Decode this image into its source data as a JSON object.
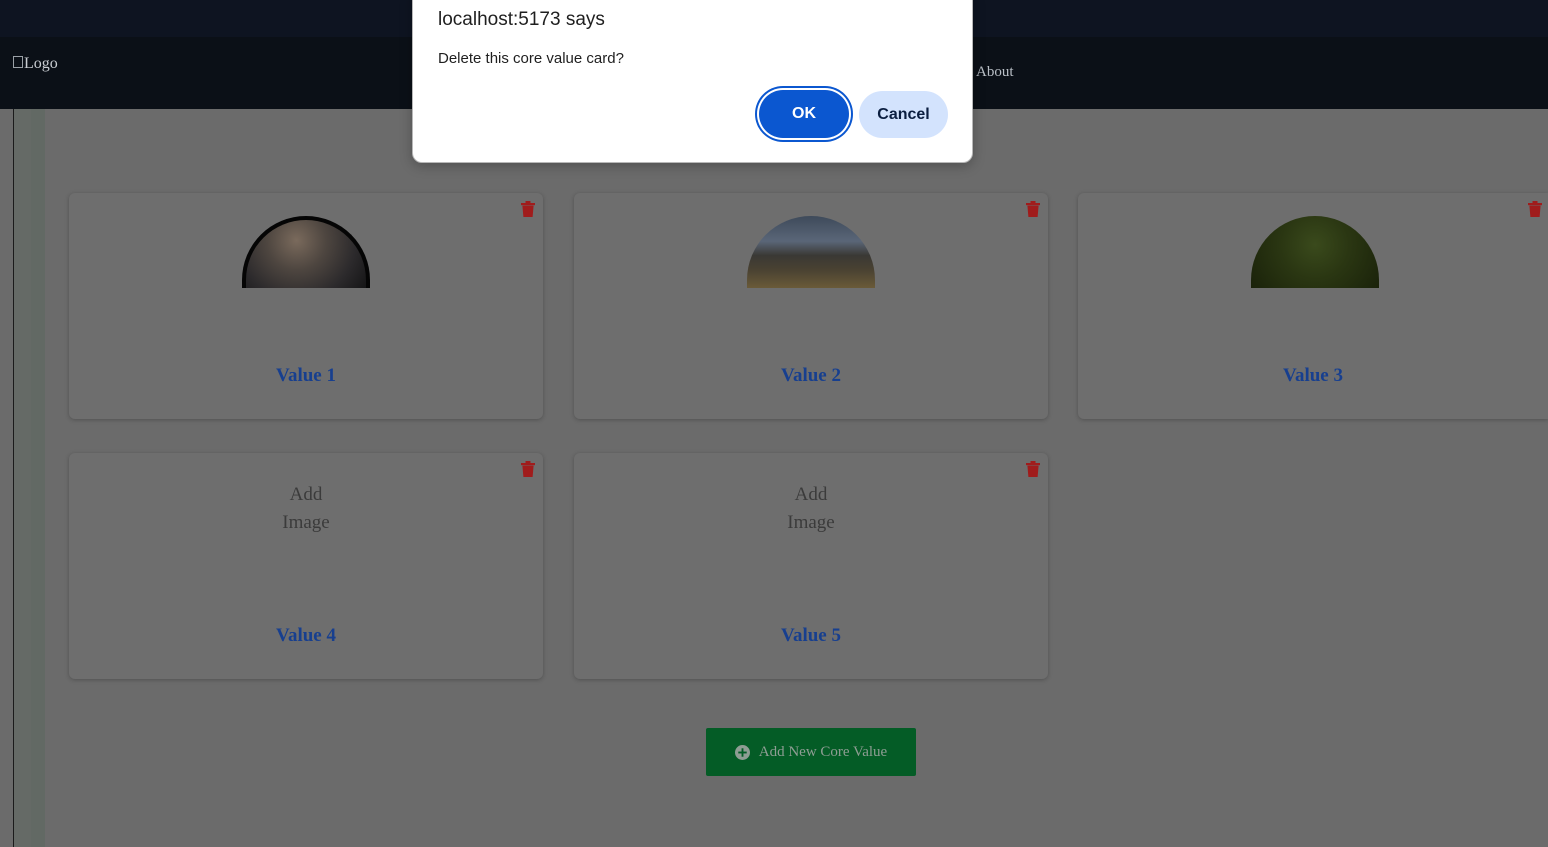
{
  "navbar": {
    "logo_alt": "Logo",
    "about": "About"
  },
  "cards": [
    {
      "label": "Value 1",
      "image": "planet-image"
    },
    {
      "label": "Value 2",
      "image": "elephants-image"
    },
    {
      "label": "Value 3",
      "image": "forest-image"
    },
    {
      "label": "Value 4",
      "add_image_line1": "Add",
      "add_image_line2": "Image"
    },
    {
      "label": "Value 5",
      "add_image_line1": "Add",
      "add_image_line2": "Image"
    }
  ],
  "add_button": {
    "label": "Add New Core Value"
  },
  "dialog": {
    "title": "localhost:5173 says",
    "message": "Delete this core value card?",
    "ok_label": "OK",
    "cancel_label": "Cancel"
  },
  "colors": {
    "card_label": "#173f8f",
    "trash": "#a01c1c",
    "add_button_bg": "#045c26",
    "ok_bg": "#0b57d0",
    "cancel_bg": "#d3e3fd"
  }
}
